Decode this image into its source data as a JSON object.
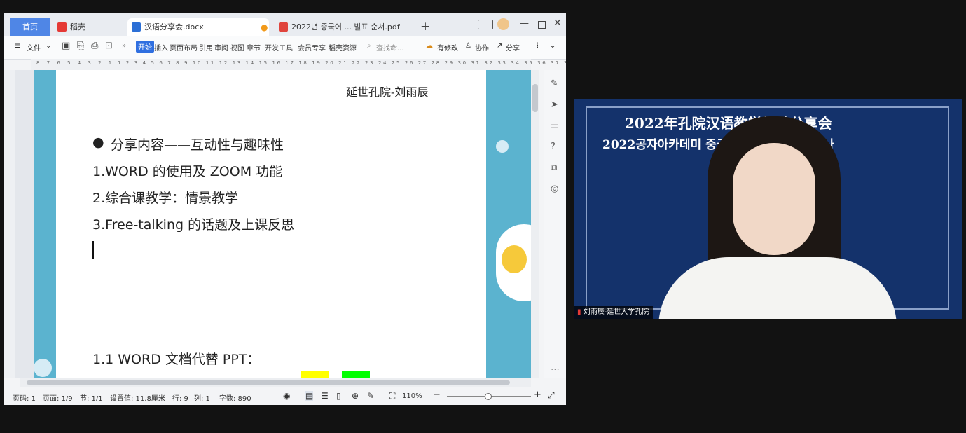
{
  "window": {
    "tabs": [
      {
        "label": "首页",
        "icon": "home-tab"
      },
      {
        "label": "稻壳",
        "icon": "daoke-icon"
      },
      {
        "label": "汉语分享会.docx",
        "icon": "word-doc-icon"
      },
      {
        "label": "2022년 중국어 ... 발표 순서.pdf",
        "icon": "pdf-icon"
      }
    ],
    "new_tab": "+"
  },
  "toolbar": {
    "file": "文件",
    "menu": [
      "开始",
      "插入",
      "页面布局",
      "引用",
      "审阅",
      "视图",
      "章节",
      "开发工具",
      "会员专享",
      "稻壳资源"
    ],
    "search": "查找命...",
    "edit_status": "有修改",
    "collab": "协作",
    "share": "分享"
  },
  "ruler": {
    "left": "8 7 6 5 4 3 2 1",
    "right": "1 2 3 4 5 6 7 8 9 10 11 12 13 14 15 16 17 18 19 20 21 22 23 24 25 26 27 28 29 30 31 32 33 34 35 36 37 38 39 40 41 42 43 44 45 46"
  },
  "document": {
    "header": "延世孔院-刘雨辰",
    "lines": [
      "分享内容——互动性与趣味性",
      "1.WORD 的使用及 ZOOM 功能",
      "2.综合课教学：情景教学",
      "3.Free-talking 的话题及上课反思",
      "1.1 WORD 文档代替 PPT："
    ],
    "bullet": "●"
  },
  "status": {
    "page_code": "页码: 1",
    "page": "页面: 1/9",
    "section": "节: 1/1",
    "setting": "设置值: 11.8厘米",
    "row": "行: 9",
    "col": "列: 1",
    "words": "字数: 890",
    "zoom": "110%"
  },
  "video": {
    "title_cn": "2022年孔院汉语教学经验分享会",
    "title_kr": "2022공자아카데미 중국어 교수법 양성세미나",
    "name_tag": "刘雨辰-延世大学孔院"
  }
}
